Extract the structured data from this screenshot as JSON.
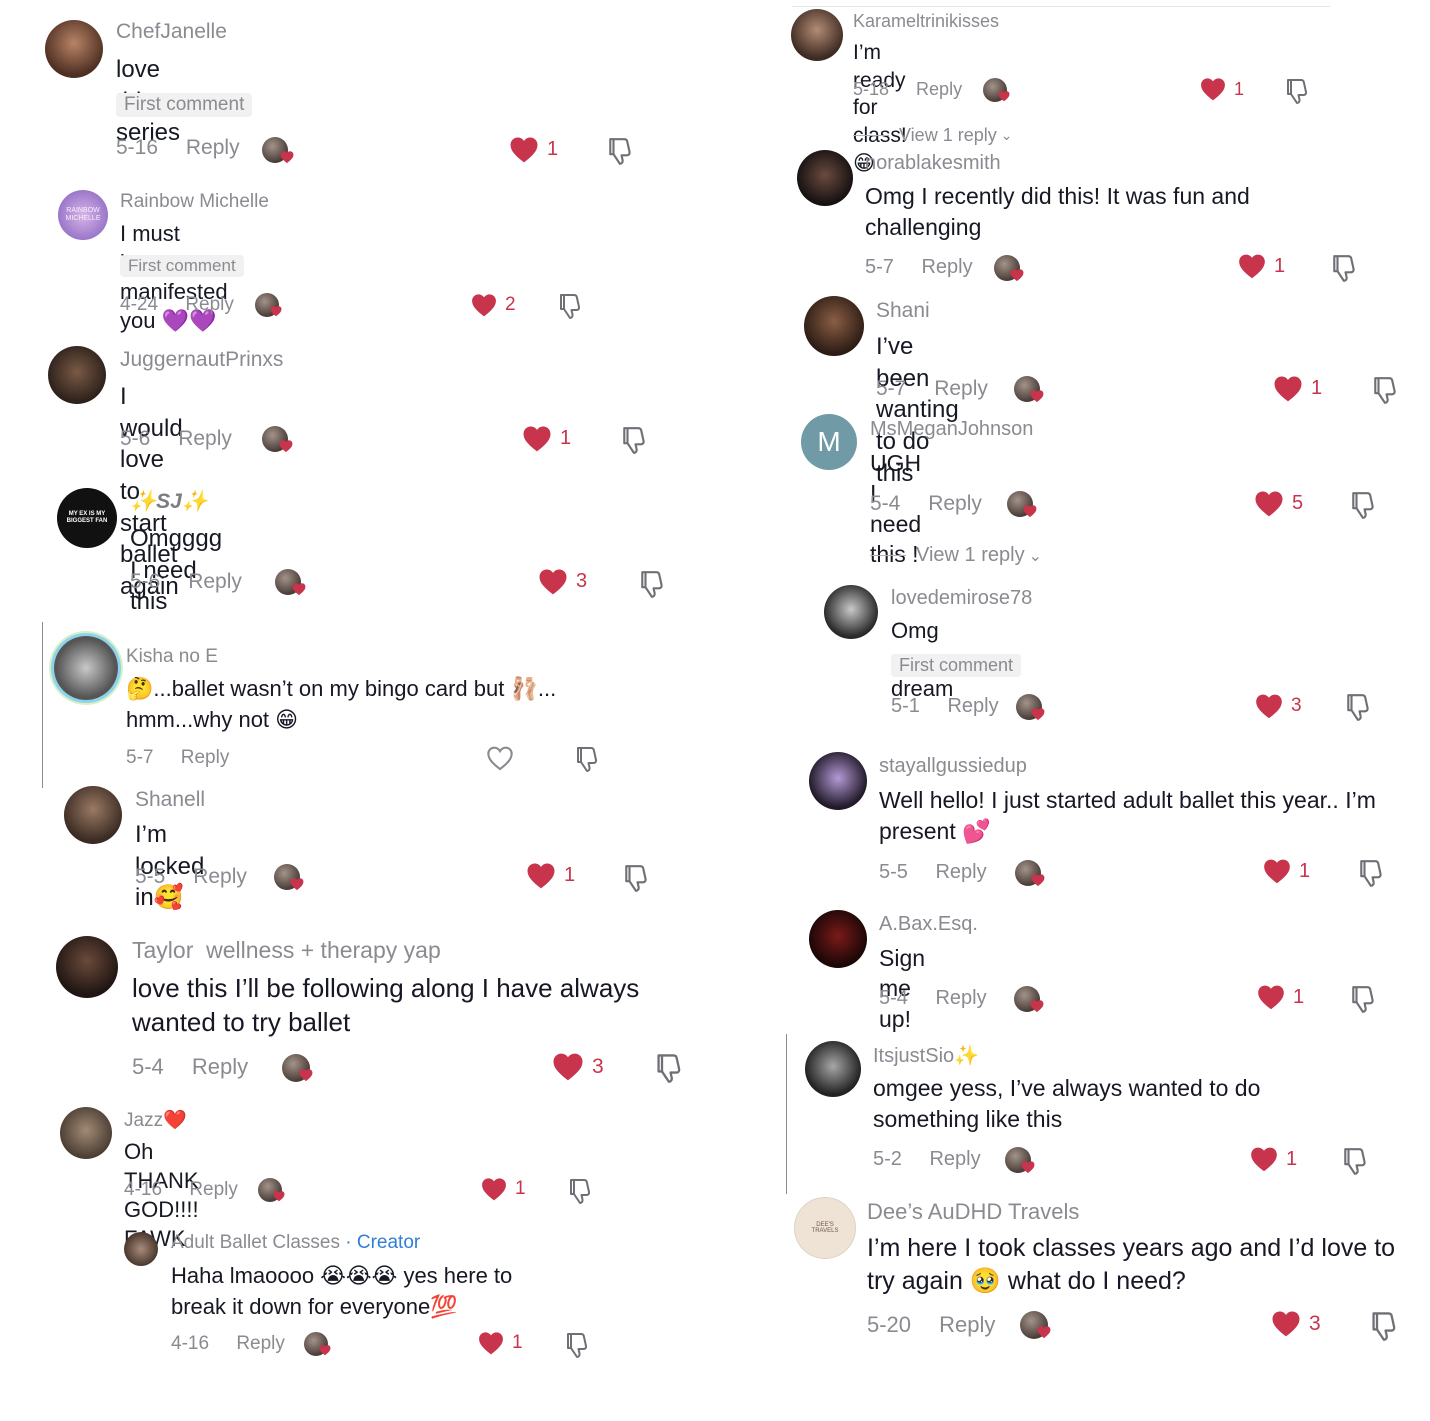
{
  "reply_label": "Reply",
  "comments": [
    {
      "user": "ChefJanelle",
      "text": "love this series",
      "badge": "First comment",
      "date": "5-16",
      "likes": "1"
    },
    {
      "user": "Rainbow Michelle",
      "text": "I must have manifested you 💜💜",
      "badge": "First comment",
      "date": "4-24",
      "likes": "2",
      "avatar_text": "RAINBOW MICHELLE"
    },
    {
      "user": "JuggernautPrinxs",
      "text": "I would love to start ballet again",
      "date": "5-6",
      "likes": "1"
    },
    {
      "user": "✨SJ✨",
      "text": "Omgggg I need this",
      "date": "5-6",
      "likes": "3",
      "avatar_text": "MY EX IS MY BIGGEST FAN"
    },
    {
      "user": "Kisha no E",
      "text": "🤔...ballet wasn’t on my bingo card but 🩰... hmm...why not 😁",
      "date": "5-7",
      "likes": ""
    },
    {
      "user": "Shanell",
      "text": "I’m locked in🥰",
      "date": "5-5",
      "likes": "1"
    },
    {
      "user": "Taylor  wellness + therapy yap",
      "text": "love this I’ll be following along I have always wanted to try ballet",
      "date": "5-4",
      "likes": "3"
    },
    {
      "user": "Jazz❤️",
      "text": "Oh THANK GOD!!!! FAWK",
      "date": "4-16",
      "likes": "1"
    },
    {
      "user": "Adult Ballet Classes",
      "creator": " · Creator",
      "text": "Haha lmaoooo 😭😭😭 yes here to break it down for everyone💯",
      "date": "4-16",
      "likes": "1"
    },
    {
      "user": "Karameltrinikisses",
      "text": "I’m ready for class! 😁",
      "date": "5-18",
      "likes": "1"
    },
    {
      "user": "norablakesmith",
      "text": "Omg I recently did this! It was fun and challenging",
      "date": "5-7",
      "likes": "1"
    },
    {
      "user": "Shani",
      "text": "I’ve been wanting to do this",
      "date": "5-7",
      "likes": "1"
    },
    {
      "user": "MsMeganJohnson",
      "text": "UGH I need this !",
      "date": "5-4",
      "likes": "5",
      "avatar_text": "M"
    },
    {
      "user": "lovedemirose78",
      "text": "Omg my dream",
      "badge": "First comment",
      "date": "5-1",
      "likes": "3"
    },
    {
      "user": "stayallgussiedup",
      "text": "Well hello! I just started adult ballet this year.. I’m present 💕",
      "date": "5-5",
      "likes": "1"
    },
    {
      "user": "A.Bax.Esq.",
      "text": "Sign me up!",
      "date": "5-4",
      "likes": "1"
    },
    {
      "user": "ItsjustSio✨",
      "text": "omgee yess, I’ve always wanted to do something like this",
      "date": "5-2",
      "likes": "1"
    },
    {
      "user": "Dee’s AuDHD Travels",
      "text": "I’m here I took classes years ago and I’d love to try again 🥹 what do I need?",
      "date": "5-20",
      "likes": "3",
      "avatar_text": "DEE'S TRAVELS"
    }
  ],
  "view_replies": [
    "View 1 reply",
    "View 1 reply"
  ],
  "colors": {
    "heart": "#c8344c",
    "muted": "#8a8b91",
    "creator": "#2f7fd6"
  },
  "icons": {
    "like": "heart-icon",
    "dislike": "thumbs-down-icon",
    "chevron": "chevron-down-icon"
  }
}
